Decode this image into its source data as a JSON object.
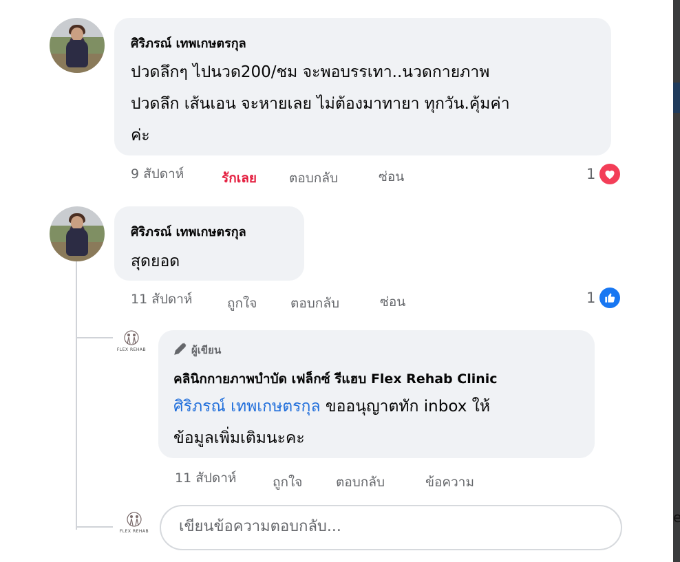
{
  "comments": [
    {
      "author": "ศิริภรณ์ เทพเกษตรกุล",
      "lines": [
        "ปวดลึกๆ ไปนวด200/ชม จะพอบรรเทา..นวดกายภาพ",
        "ปวดลึก เส้นเอน จะหายเลย ไม่ต้องมาทายา ทุกวัน.คุ้มค่า",
        "ค่ะ"
      ],
      "time": "9 สัปดาห์",
      "reaction_label": "รักเลย",
      "reply": "ตอบกลับ",
      "hide": "ซ่อน",
      "reaction_count": "1",
      "reaction_icon": "heart-icon"
    },
    {
      "author": "ศิริภรณ์ เทพเกษตรกุล",
      "text": "สุดยอด",
      "time": "11 สัปดาห์",
      "like": "ถูกใจ",
      "reply": "ตอบกลับ",
      "hide": "ซ่อน",
      "reaction_count": "1",
      "reaction_icon": "like-icon"
    }
  ],
  "page_reply": {
    "badge_icon": "pencil-icon",
    "badge": "ผู้เขียน",
    "author": "คลินิกกายภาพบำบัด เฟล็กซ์ รีแฮบ Flex Rehab Clinic",
    "mention": "ศิริภรณ์ เทพเกษตรกุล",
    "text_after_mention": " ขออนุญาตทัก inbox ให้",
    "line2": "ข้อมูลเพิ่มเติมนะคะ",
    "time": "11 สัปดาห์",
    "like": "ถูกใจ",
    "reply": "ตอบกลับ",
    "message": "ข้อความ",
    "logo_text": "FLEX REHAB"
  },
  "reply_box": {
    "placeholder": "เขียนข้อความตอบกลับ..."
  },
  "colors": {
    "bubble": "#f0f2f5",
    "mention": "#216fdb",
    "love": "#e41e3f",
    "like": "#1877f2",
    "heart": "#f33e58",
    "meta": "#65676b"
  }
}
